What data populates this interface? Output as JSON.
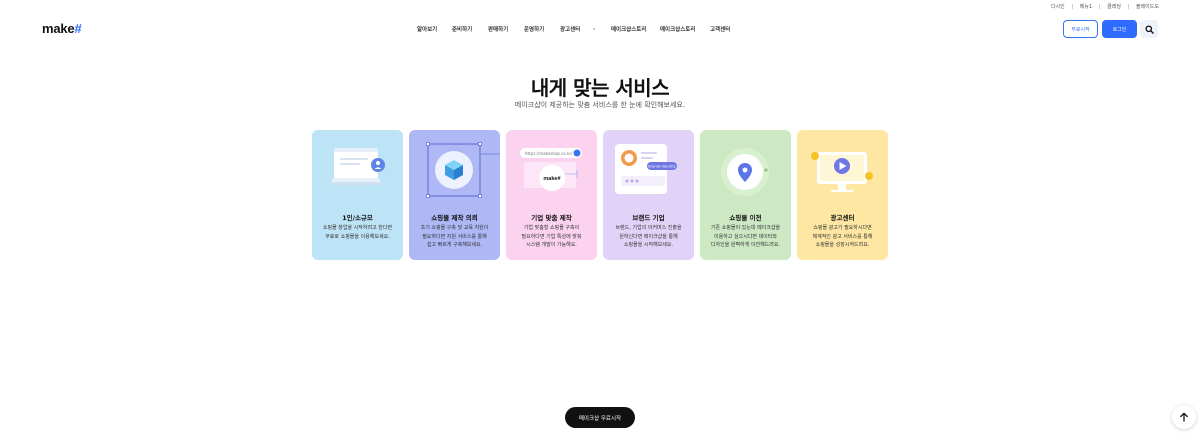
{
  "utility": [
    "다시인",
    "메뉴1",
    "클래딩",
    "블레이드도"
  ],
  "logo": {
    "text": "make",
    "hash": "#"
  },
  "gnb": {
    "items": [
      "알아보기",
      "준비하기",
      "판매하기",
      "운영하기",
      "광고센터",
      "메이크샵스토리",
      "메이크샵스토리",
      "고객센터"
    ]
  },
  "header": {
    "free_start_label": "무료시작",
    "login_label": "로그인",
    "search_icon": "search-icon"
  },
  "main": {
    "title": "내게 맞는 서비스",
    "subtitle": "메이크샵이 제공하는 맞춤 서비스를 한 눈에 확인해보세요."
  },
  "cards": [
    {
      "title": "1인/소규모",
      "desc": "쇼핑몰 창업을 시작하려고 한다면\n무료로 쇼핑몰을 이용해보세요.",
      "bg": "#bde3f6"
    },
    {
      "title": "쇼핑몰 제작 의뢰",
      "desc": "초기 쇼핑몰 구축 및 교육 지원이\n필요하다면 지원 서비스를 통해\n쉽고 빠르게 구축해보세요.",
      "bg": "#aeb8f5"
    },
    {
      "title": "기업 맞춤 제작",
      "desc": "기업 맞춤형 쇼핑몰 구축이\n필요하다면 기업 특성에 맞춰\n시스템 개발이 가능해요.",
      "bg": "#fbd3ee"
    },
    {
      "title": "브랜드 기업",
      "desc": "브랜드, 기업의 이커머스 진출을\n원하신다면 메이크샵을 통해\n쇼핑몰을 시작해보세요.",
      "bg": "#e0d3f7"
    },
    {
      "title": "쇼핑몰 이전",
      "desc": "기존 쇼핑몰이 있는데 메이크샵을\n이용하고 싶으시다면 데이터와\n디자인을 완벽하게 이전해드려요.",
      "bg": "#cde9c4"
    },
    {
      "title": "광고센터",
      "desc": "쇼핑몰 광고가 필요하시다면\n체계적인 광고 서비스를 통해\n쇼핑몰을 성장시켜드려요.",
      "bg": "#fde7a3"
    }
  ],
  "illus_text": {
    "url": "https://makeshop.co.kr/",
    "make_badge": "make#",
    "brand_identity": "Brands Identity"
  },
  "cta": {
    "label": "메이크샵 무료시작"
  },
  "top_button": {
    "icon": "arrow-up-icon"
  }
}
